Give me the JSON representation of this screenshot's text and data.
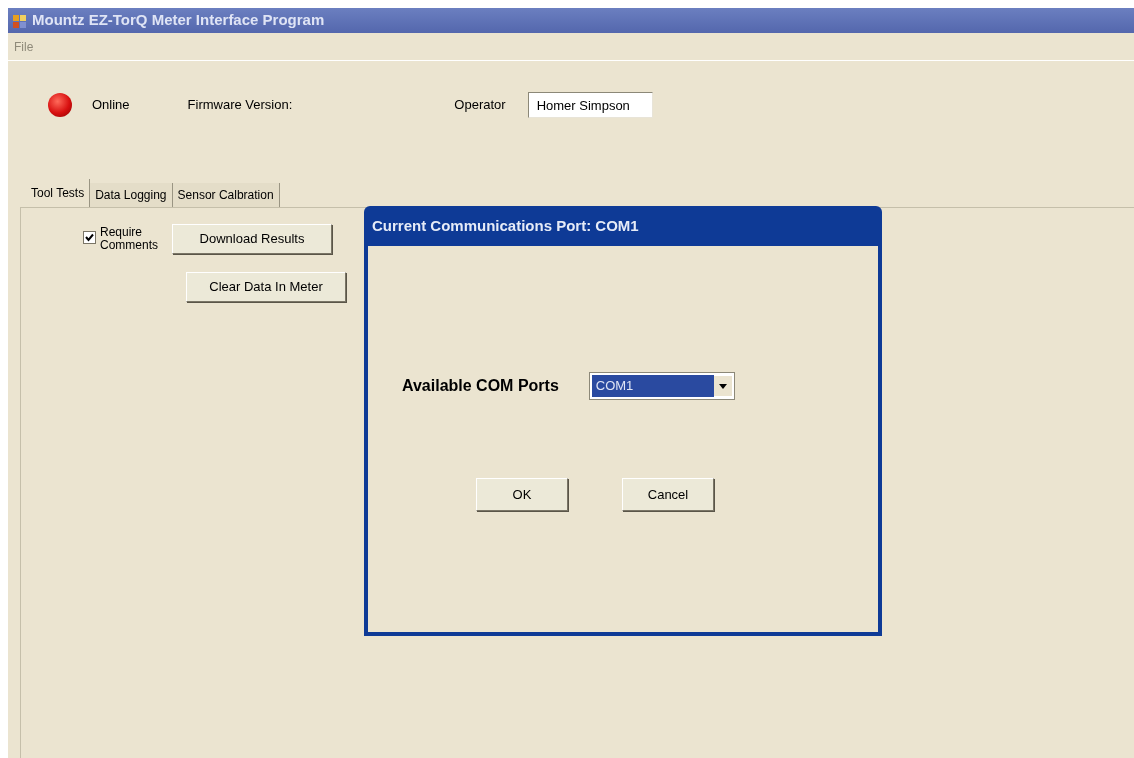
{
  "window": {
    "title": "Mountz EZ-TorQ Meter Interface Program"
  },
  "menu": [
    {
      "label": "File",
      "disabled": true
    }
  ],
  "status": {
    "lit": true,
    "label": "Online"
  },
  "firmware": {
    "label": "Firmware Version:"
  },
  "operator": {
    "label": "Operator",
    "value": "Homer Simpson"
  },
  "tabs": [
    {
      "label": "Tool Tests",
      "selected": true
    },
    {
      "label": "Data Logging",
      "selected": false
    },
    {
      "label": "Sensor Calbration",
      "selected": false
    }
  ],
  "require_comments": {
    "label": "Require Comments",
    "checked": true
  },
  "buttons": [
    "Download Results",
    "Clear Data In Meter"
  ],
  "dialog": {
    "title": "Current Communications Port: COM1",
    "field_label": "Available COM Ports",
    "value": "COM1",
    "buttons": [
      "OK",
      "Cancel"
    ]
  }
}
